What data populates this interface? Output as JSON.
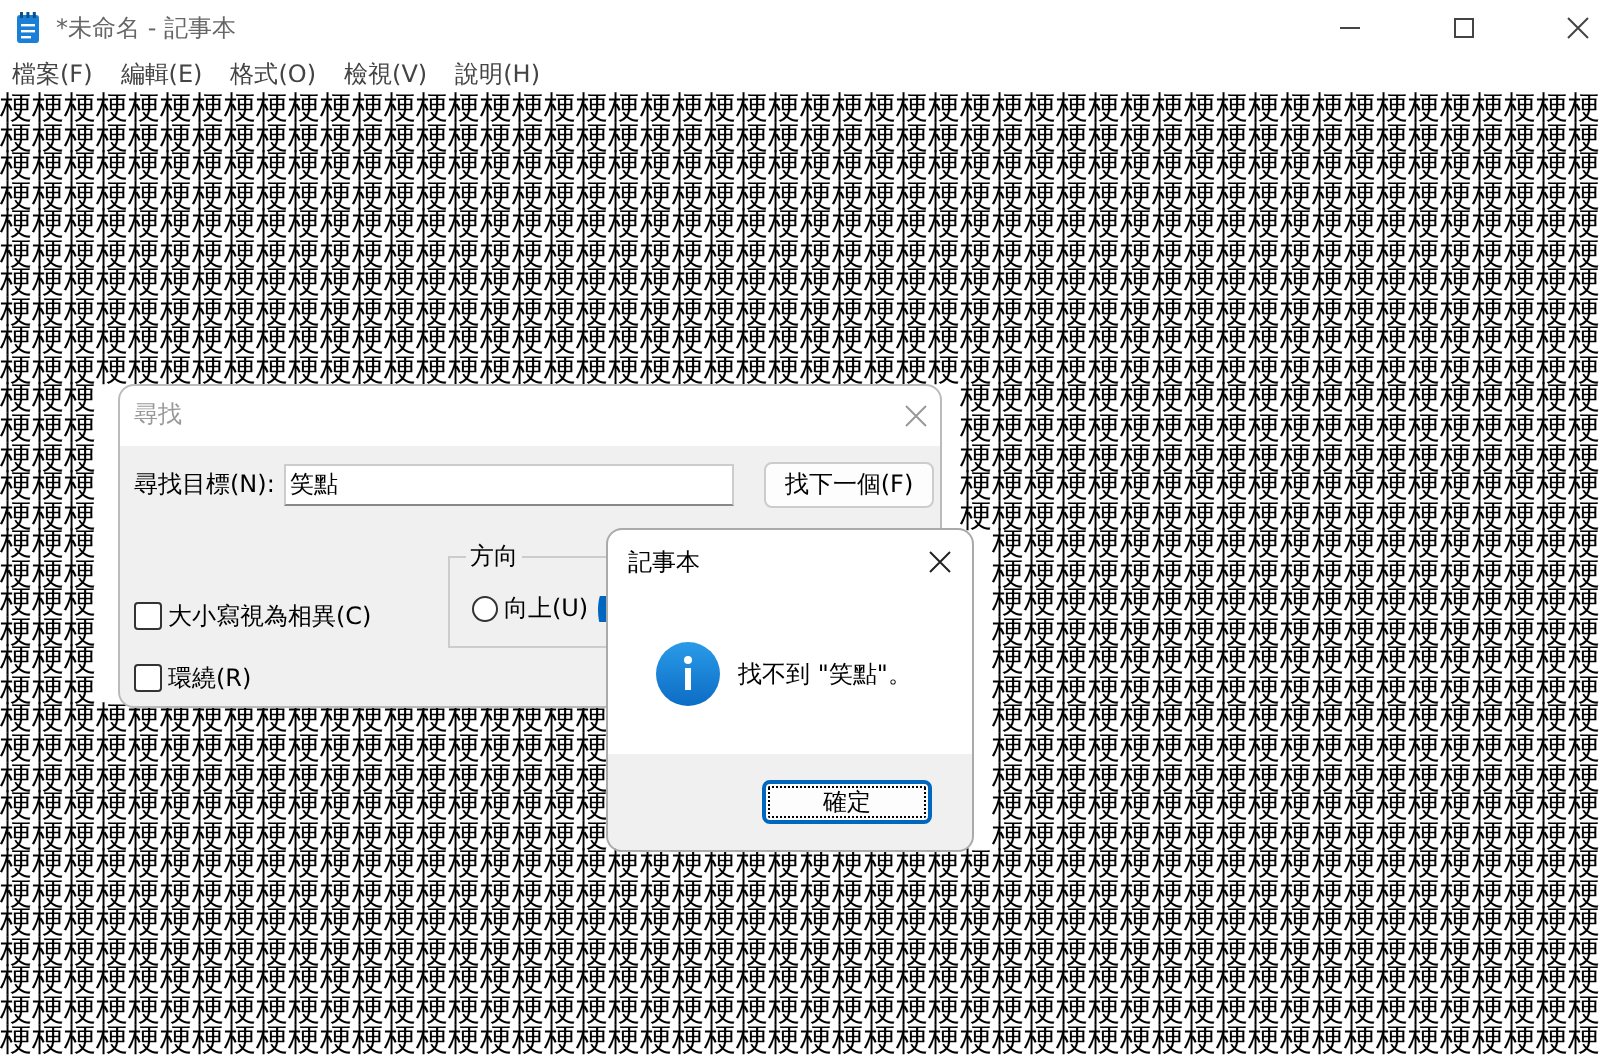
{
  "window": {
    "title": "*未命名 - 記事本"
  },
  "menu": [
    "檔案(F)",
    "編輯(E)",
    "格式(O)",
    "檢視(V)",
    "說明(H)"
  ],
  "editor": {
    "lines": [
      [
        "梗梗梗梗梗梗梗梗梗梗梗梗梗梗梗梗梗梗梗梗梗梗梗梗梗梗梗梗梗梗梗梗梗梗梗梗梗梗梗梗梗梗梗梗梗梗梗梗梗梗"
      ],
      [
        "梗梗梗梗梗梗梗梗梗梗梗梗梗梗梗梗梗梗梗梗梗梗梗梗梗梗梗梗梗梗梗梗梗梗梗梗梗梗梗梗梗梗梗梗梗梗梗梗梗梗"
      ],
      [
        "梗梗梗梗梗梗梗梗梗梗梗梗梗梗梗梗梗梗梗梗梗梗梗梗梗梗梗梗梗梗梗梗梗梗梗梗梗梗梗梗梗梗梗梗梗梗梗梗梗梗"
      ],
      [
        "梗梗梗梗梗梗梗梗梗梗梗梗梗梗梗梗梗梗梗梗梗梗梗梗梗梗梗梗梗梗梗梗梗梗梗梗梗梗梗梗梗梗梗梗梗梗梗梗梗梗"
      ],
      [
        "梗梗梗梗梗梗梗梗梗梗梗梗梗梗梗梗梗梗梗梗梗梗梗梗梗梗梗梗梗梗梗梗梗梗梗梗梗梗梗梗梗梗梗梗梗梗梗梗梗梗"
      ],
      [
        "梗梗梗梗梗梗梗梗梗梗梗梗梗梗梗梗梗梗梗梗梗梗梗梗梗梗梗梗梗梗梗梗梗梗梗梗梗梗梗梗梗梗梗梗梗梗梗梗梗梗"
      ],
      [
        "梗梗梗梗梗梗梗梗梗梗梗梗梗梗梗梗梗梗梗梗梗梗梗梗梗梗梗梗梗梗梗梗梗梗梗梗梗梗梗梗梗梗梗梗梗梗梗梗梗梗"
      ],
      [
        "梗梗梗梗梗梗梗梗梗梗梗梗梗梗梗梗梗梗梗梗梗梗梗梗梗梗梗梗梗梗梗梗梗梗梗梗梗梗梗梗梗梗梗梗梗梗梗梗梗梗"
      ],
      [
        "梗梗梗梗梗梗梗梗梗梗梗梗梗梗梗梗梗梗梗梗梗梗梗梗梗梗梗梗梗梗梗梗梗梗梗梗梗梗梗梗梗梗梗梗梗梗梗梗梗梗"
      ],
      [
        "梗梗梗梗梗梗梗梗梗梗梗梗梗梗梗梗梗梗梗梗梗梗梗梗梗梗梗梗梗梗梗梗梗梗梗梗梗梗梗梗梗梗梗梗梗梗梗梗梗梗"
      ],
      [
        "梗梗梗",
        "梗梗梗梗梗梗梗梗梗梗梗梗梗梗梗梗梗梗梗梗"
      ],
      [
        "梗梗梗",
        "梗梗梗梗梗梗梗梗梗梗梗梗梗梗梗梗梗梗梗梗"
      ],
      [
        "梗梗梗",
        "梗梗梗梗梗梗梗梗梗梗梗梗梗梗梗梗梗梗梗梗"
      ],
      [
        "梗梗梗",
        "梗梗梗梗梗梗梗梗梗梗梗梗梗梗梗梗梗梗梗梗"
      ],
      [
        "梗梗梗",
        "梗梗梗梗梗梗梗梗梗梗梗梗梗梗梗梗梗梗梗梗"
      ],
      [
        "梗梗梗",
        "梗梗梗梗梗梗梗梗梗梗梗梗梗梗梗梗梗梗梗"
      ],
      [
        "梗梗梗",
        "梗梗梗梗梗梗梗梗梗梗梗梗梗梗梗梗梗梗梗"
      ],
      [
        "梗梗梗",
        "梗梗梗梗梗梗梗梗梗梗梗梗梗梗梗梗梗梗梗"
      ],
      [
        "梗梗梗",
        "梗梗梗梗梗梗梗梗梗梗梗梗梗梗梗梗梗梗梗"
      ],
      [
        "梗梗梗",
        "梗梗梗梗梗梗梗梗梗梗梗梗梗梗梗梗梗梗梗"
      ],
      [
        "梗梗梗",
        "梗梗梗梗梗梗梗梗梗梗梗梗梗梗梗梗梗梗梗"
      ],
      [
        "梗梗梗梗梗梗梗梗梗梗梗梗梗梗梗梗梗梗梗",
        "梗梗梗梗梗梗梗梗梗梗梗梗梗梗梗梗梗梗梗"
      ],
      [
        "梗梗梗梗梗梗梗梗梗梗梗梗梗梗梗梗梗梗梗",
        "梗梗梗梗梗梗梗梗梗梗梗梗梗梗梗梗梗梗梗"
      ],
      [
        "梗梗梗梗梗梗梗梗梗梗梗梗梗梗梗梗梗梗梗",
        "梗梗梗梗梗梗梗梗梗梗梗梗梗梗梗梗梗梗梗"
      ],
      [
        "梗梗梗梗梗梗梗梗梗梗梗梗梗梗梗梗梗梗梗",
        "梗梗梗梗梗梗梗梗梗梗梗梗梗梗梗梗梗梗梗"
      ],
      [
        "梗梗梗梗梗梗梗梗梗梗梗梗梗梗梗梗梗梗梗",
        "梗梗梗梗梗梗梗梗梗梗梗梗梗梗梗梗梗梗梗"
      ],
      [
        "梗梗梗梗梗梗梗梗梗梗梗梗梗梗梗梗梗梗梗梗梗梗梗梗梗梗梗梗梗梗梗梗梗梗梗梗梗梗梗梗梗梗梗梗梗梗梗梗梗梗"
      ],
      [
        "梗梗梗梗梗梗梗梗梗梗梗梗梗梗梗梗梗梗梗梗梗梗梗梗梗梗梗梗梗梗梗梗梗梗梗梗梗梗梗梗梗梗梗梗梗梗梗梗梗梗"
      ],
      [
        "梗梗梗梗梗梗梗梗梗梗梗梗梗梗梗梗梗梗梗梗梗梗梗梗梗梗梗梗梗梗梗梗梗梗梗梗梗梗梗梗梗梗梗梗梗梗梗梗梗梗"
      ],
      [
        "梗梗梗梗梗梗梗梗梗梗梗梗梗梗梗梗梗梗梗梗梗梗梗梗梗梗梗梗梗梗梗梗梗梗梗梗梗梗梗梗梗梗梗梗梗梗梗梗梗梗"
      ],
      [
        "梗梗梗梗梗梗梗梗梗梗梗梗梗梗梗梗梗梗梗梗梗梗梗梗梗梗梗梗梗梗梗梗梗梗梗梗梗梗梗梗梗梗梗梗梗梗梗梗梗梗"
      ],
      [
        "梗梗梗梗梗梗梗梗梗梗梗梗梗梗梗梗梗梗梗梗梗梗梗梗梗梗梗梗梗梗梗梗梗梗梗梗梗梗梗梗梗梗梗梗梗梗梗梗梗梗"
      ],
      [
        "梗梗梗梗梗梗梗梗梗梗梗梗梗梗梗梗梗梗梗梗梗梗梗梗梗梗梗梗梗梗梗梗梗梗梗梗梗梗梗梗梗梗梗梗梗梗梗梗梗梗"
      ]
    ]
  },
  "find_dialog": {
    "title": "尋找",
    "label": "尋找目標(N):",
    "value": "笑點",
    "find_next": "找下一個(F)",
    "direction_label": "方向",
    "radios": [
      {
        "label": "向上(U)",
        "selected": false
      },
      {
        "selected": true
      }
    ],
    "checkboxes": [
      {
        "label": "大小寫視為相異(C)",
        "checked": false
      },
      {
        "label": "環繞(R)",
        "checked": false
      }
    ]
  },
  "message_box": {
    "title": "記事本",
    "message": "找不到 \"笑點\"。",
    "button": "確定"
  }
}
